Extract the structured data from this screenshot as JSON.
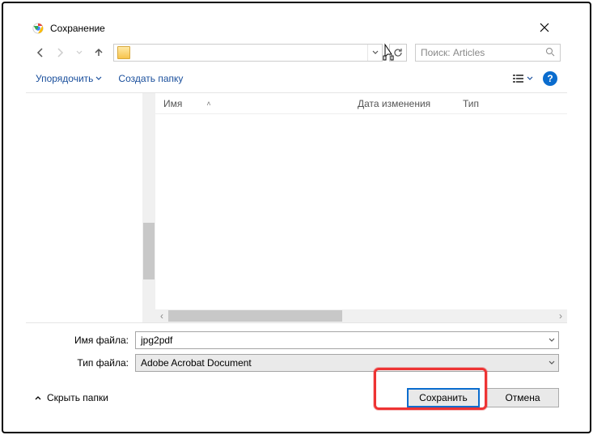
{
  "titlebar": {
    "title": "Сохранение"
  },
  "nav": {
    "path_text": "",
    "refresh_label": "↻"
  },
  "search": {
    "placeholder": "Поиск: Articles"
  },
  "toolbar": {
    "organize": "Упорядочить",
    "new_folder": "Создать папку",
    "help_char": "?"
  },
  "columns": {
    "name": "Имя",
    "date": "Дата изменения",
    "type": "Тип"
  },
  "form": {
    "filename_label": "Имя файла:",
    "filetype_label": "Тип файла:",
    "filename_value": "jpg2pdf",
    "filetype_value": "Adobe Acrobat Document"
  },
  "footer": {
    "hide_folders": "Скрыть папки",
    "save": "Сохранить",
    "cancel": "Отмена"
  }
}
